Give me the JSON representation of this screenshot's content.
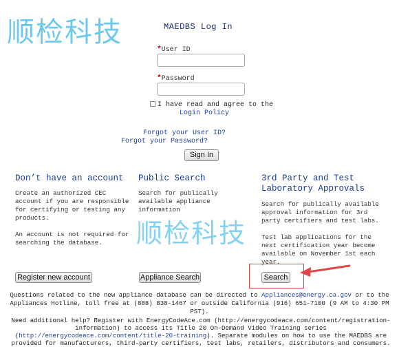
{
  "watermark_text": "顺检科技",
  "title": "MAEDBS Log In",
  "login": {
    "required_mark": "*",
    "user_id_label": "User ID",
    "password_label": "Password",
    "agree_text": "I have read and agree to the",
    "login_policy": "Login Policy",
    "forgot_user_id": "Forgot your User ID?",
    "forgot_password": "Forgot your Password?",
    "sign_in": "Sign In"
  },
  "columns": {
    "account": {
      "title": "Don’t have an account",
      "text1": "Create an authorized CEC account if you are responsible for certifying or testing any products.",
      "text2": "An account is not required for searching the database.",
      "button": "Register new account"
    },
    "public": {
      "title": "Public Search",
      "text1": "Search for publically available appliance information",
      "button": "Appliance Search"
    },
    "third_party": {
      "title": "3rd Party and Test Laboratory Approvals",
      "text1": "Search for publically available approval information for 3rd party certifiers and test labs.",
      "text2": "Test lab applications for the next certification year become available on November 1st each year.",
      "button": "Search"
    }
  },
  "footer": {
    "line1_a": "Questions related to the new appliance database can be directed to ",
    "line1_email": "Appliances@energy.ca.gov",
    "line1_b": " or to the Appliances Hotline, toll free at (888) 838-1467 or outside California (916) 651-7100 (9 AM to 4:30 PM PST).",
    "line2_a": "Need additional help? Register with EnergyCodeAce.com (http://energycodeace.com/content/registration-information) to access its Title 20 On-Demand Video Training series (",
    "line2_link": "http://energycodeace.com/content/title-20-training",
    "line2_b": "). Separate modules on how to use the MAEDBS are provided for manufacturers, third-party certifiers, test labs, retailers, distributors and consumers. The site also provides useful industry links"
  },
  "colors": {
    "watermark": "#5bc3ee",
    "link": "#1f3fa0",
    "heading": "#1a3a8a",
    "required": "#d00000",
    "annotation": "#e04848"
  }
}
